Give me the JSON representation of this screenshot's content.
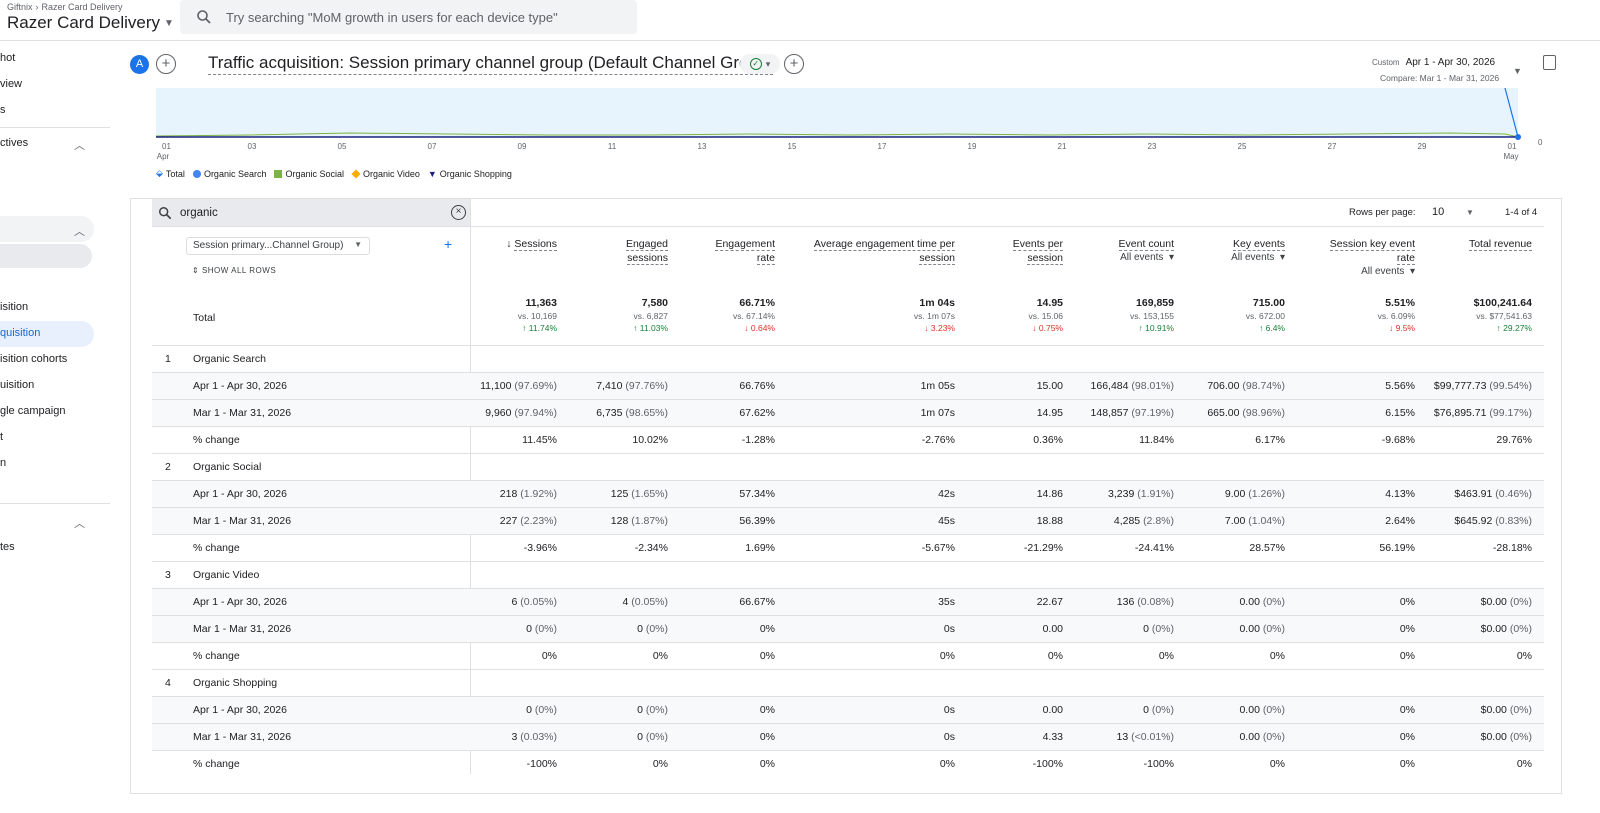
{
  "header": {
    "breadcrumb_account": "Giftnix",
    "breadcrumb_property": "Razer Card Delivery",
    "property_title": "Razer Card Delivery",
    "search_placeholder": "Try searching \"MoM growth in users for each device type\""
  },
  "leftnav": {
    "items": [
      "hot",
      "view",
      "s",
      "ctives",
      "isition",
      "quisition",
      "isition cohorts",
      "uisition",
      "gle campaign",
      "t",
      "n",
      "tes"
    ]
  },
  "report": {
    "avatar_letter": "A",
    "title": "Traffic acquisition: Session primary channel group (Default Channel Group)",
    "date_label": "Custom",
    "date_range": "Apr 1 - Apr 30, 2026",
    "compare_range": "Compare: Mar 1 - Mar 31, 2026"
  },
  "chart_data": {
    "type": "line",
    "x_tick_labels": [
      "01",
      "03",
      "05",
      "07",
      "09",
      "11",
      "13",
      "15",
      "17",
      "19",
      "21",
      "23",
      "25",
      "27",
      "29",
      "01"
    ],
    "x_month_labels": {
      "first": "Apr",
      "last": "May"
    },
    "y_tick_labels": [
      "0"
    ],
    "legend": [
      {
        "name": "Total",
        "color": "#1a73e8"
      },
      {
        "name": "Organic Search",
        "color": "#4285f4"
      },
      {
        "name": "Organic Social",
        "color": "#7cb342"
      },
      {
        "name": "Organic Video",
        "color": "#f9ab00"
      },
      {
        "name": "Organic Shopping",
        "color": "#1a237e"
      }
    ]
  },
  "table": {
    "filter_value": "organic",
    "rows_per_page_label": "Rows per page:",
    "rows_per_page_value": "10",
    "page_info": "1-4 of 4",
    "dimension_select": "Session primary...Channel Group)",
    "show_all_rows": "SHOW ALL ROWS",
    "total_label": "Total",
    "columns": [
      {
        "title": "Sessions",
        "sort": "↓"
      },
      {
        "title": "Engaged\nsessions"
      },
      {
        "title": "Engagement\nrate"
      },
      {
        "title": "Average engagement time per\nsession"
      },
      {
        "title": "Events per\nsession"
      },
      {
        "title": "Event count",
        "sub": "All events"
      },
      {
        "title": "Key events",
        "sub": "All events"
      },
      {
        "title": "Session key event\nrate",
        "sub": "All events"
      },
      {
        "title": "Total revenue"
      }
    ],
    "totals": [
      {
        "value": "11,363",
        "compare": "vs. 10,169",
        "delta": "↑ 11.74%",
        "dir": "up"
      },
      {
        "value": "7,580",
        "compare": "vs. 6,827",
        "delta": "↑ 11.03%",
        "dir": "up"
      },
      {
        "value": "66.71%",
        "compare": "vs. 67.14%",
        "delta": "↓ 0.64%",
        "dir": "down"
      },
      {
        "value": "1m 04s",
        "compare": "vs. 1m 07s",
        "delta": "↓ 3.23%",
        "dir": "down"
      },
      {
        "value": "14.95",
        "compare": "vs. 15.06",
        "delta": "↓ 0.75%",
        "dir": "down"
      },
      {
        "value": "169,859",
        "compare": "vs. 153,155",
        "delta": "↑ 10.91%",
        "dir": "up"
      },
      {
        "value": "715.00",
        "compare": "vs. 672.00",
        "delta": "↑ 6.4%",
        "dir": "up"
      },
      {
        "value": "5.51%",
        "compare": "vs. 6.09%",
        "delta": "↓ 9.5%",
        "dir": "down"
      },
      {
        "value": "$100,241.64",
        "compare": "vs. $77,541.63",
        "delta": "↑ 29.27%",
        "dir": "up"
      }
    ],
    "groups": [
      {
        "rank": "1",
        "name": "Organic Search",
        "rows": [
          {
            "label": "Apr 1 - Apr 30, 2026",
            "cells": [
              [
                "11,100",
                "(97.69%)"
              ],
              [
                "7,410",
                "(97.76%)"
              ],
              [
                "66.76%"
              ],
              [
                "1m 05s"
              ],
              [
                "15.00"
              ],
              [
                "166,484",
                "(98.01%)"
              ],
              [
                "706.00",
                "(98.74%)"
              ],
              [
                "5.56%"
              ],
              [
                "$99,777.73",
                "(99.54%)"
              ]
            ]
          },
          {
            "label": "Mar 1 - Mar 31, 2026",
            "cells": [
              [
                "9,960",
                "(97.94%)"
              ],
              [
                "6,735",
                "(98.65%)"
              ],
              [
                "67.62%"
              ],
              [
                "1m 07s"
              ],
              [
                "14.95"
              ],
              [
                "148,857",
                "(97.19%)"
              ],
              [
                "665.00",
                "(98.96%)"
              ],
              [
                "6.15%"
              ],
              [
                "$76,895.71",
                "(99.17%)"
              ]
            ]
          },
          {
            "label": "% change",
            "cells": [
              [
                "11.45%"
              ],
              [
                "10.02%"
              ],
              [
                "-1.28%"
              ],
              [
                "-2.76%"
              ],
              [
                "0.36%"
              ],
              [
                "11.84%"
              ],
              [
                "6.17%"
              ],
              [
                "-9.68%"
              ],
              [
                "29.76%"
              ]
            ]
          }
        ]
      },
      {
        "rank": "2",
        "name": "Organic Social",
        "rows": [
          {
            "label": "Apr 1 - Apr 30, 2026",
            "cells": [
              [
                "218",
                "(1.92%)"
              ],
              [
                "125",
                "(1.65%)"
              ],
              [
                "57.34%"
              ],
              [
                "42s"
              ],
              [
                "14.86"
              ],
              [
                "3,239",
                "(1.91%)"
              ],
              [
                "9.00",
                "(1.26%)"
              ],
              [
                "4.13%"
              ],
              [
                "$463.91",
                "(0.46%)"
              ]
            ]
          },
          {
            "label": "Mar 1 - Mar 31, 2026",
            "cells": [
              [
                "227",
                "(2.23%)"
              ],
              [
                "128",
                "(1.87%)"
              ],
              [
                "56.39%"
              ],
              [
                "45s"
              ],
              [
                "18.88"
              ],
              [
                "4,285",
                "(2.8%)"
              ],
              [
                "7.00",
                "(1.04%)"
              ],
              [
                "2.64%"
              ],
              [
                "$645.92",
                "(0.83%)"
              ]
            ]
          },
          {
            "label": "% change",
            "cells": [
              [
                "-3.96%"
              ],
              [
                "-2.34%"
              ],
              [
                "1.69%"
              ],
              [
                "-5.67%"
              ],
              [
                "-21.29%"
              ],
              [
                "-24.41%"
              ],
              [
                "28.57%"
              ],
              [
                "56.19%"
              ],
              [
                "-28.18%"
              ]
            ]
          }
        ]
      },
      {
        "rank": "3",
        "name": "Organic Video",
        "rows": [
          {
            "label": "Apr 1 - Apr 30, 2026",
            "cells": [
              [
                "6",
                "(0.05%)"
              ],
              [
                "4",
                "(0.05%)"
              ],
              [
                "66.67%"
              ],
              [
                "35s"
              ],
              [
                "22.67"
              ],
              [
                "136",
                "(0.08%)"
              ],
              [
                "0.00",
                "(0%)"
              ],
              [
                "0%"
              ],
              [
                "$0.00",
                "(0%)"
              ]
            ]
          },
          {
            "label": "Mar 1 - Mar 31, 2026",
            "cells": [
              [
                "0",
                "(0%)"
              ],
              [
                "0",
                "(0%)"
              ],
              [
                "0%"
              ],
              [
                "0s"
              ],
              [
                "0.00"
              ],
              [
                "0",
                "(0%)"
              ],
              [
                "0.00",
                "(0%)"
              ],
              [
                "0%"
              ],
              [
                "$0.00",
                "(0%)"
              ]
            ]
          },
          {
            "label": "% change",
            "cells": [
              [
                "0%"
              ],
              [
                "0%"
              ],
              [
                "0%"
              ],
              [
                "0%"
              ],
              [
                "0%"
              ],
              [
                "0%"
              ],
              [
                "0%"
              ],
              [
                "0%"
              ],
              [
                "0%"
              ]
            ]
          }
        ]
      },
      {
        "rank": "4",
        "name": "Organic Shopping",
        "rows": [
          {
            "label": "Apr 1 - Apr 30, 2026",
            "cells": [
              [
                "0",
                "(0%)"
              ],
              [
                "0",
                "(0%)"
              ],
              [
                "0%"
              ],
              [
                "0s"
              ],
              [
                "0.00"
              ],
              [
                "0",
                "(0%)"
              ],
              [
                "0.00",
                "(0%)"
              ],
              [
                "0%"
              ],
              [
                "$0.00",
                "(0%)"
              ]
            ]
          },
          {
            "label": "Mar 1 - Mar 31, 2026",
            "cells": [
              [
                "3",
                "(0.03%)"
              ],
              [
                "0",
                "(0%)"
              ],
              [
                "0%"
              ],
              [
                "0s"
              ],
              [
                "4.33"
              ],
              [
                "13",
                "(<0.01%)"
              ],
              [
                "0.00",
                "(0%)"
              ],
              [
                "0%"
              ],
              [
                "$0.00",
                "(0%)"
              ]
            ]
          },
          {
            "label": "% change",
            "cells": [
              [
                "-100%"
              ],
              [
                "0%"
              ],
              [
                "0%"
              ],
              [
                "0%"
              ],
              [
                "-100%"
              ],
              [
                "-100%"
              ],
              [
                "0%"
              ],
              [
                "0%"
              ],
              [
                "0%"
              ]
            ]
          }
        ]
      }
    ]
  }
}
